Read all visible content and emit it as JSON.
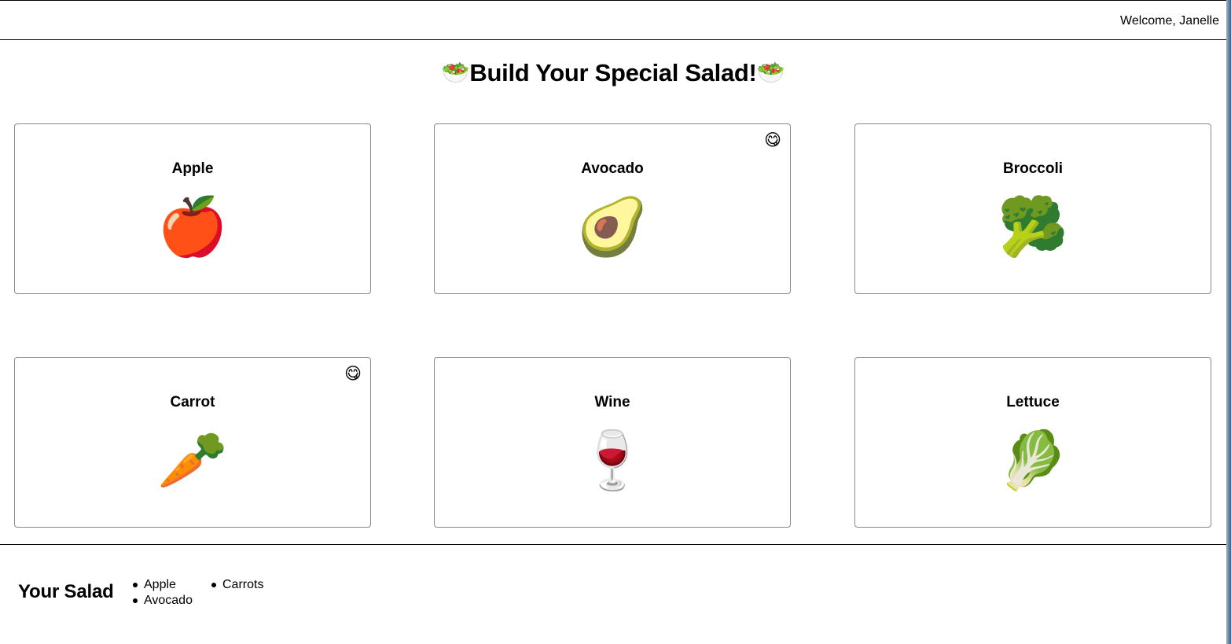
{
  "header": {
    "welcome_text": "Welcome, Janelle"
  },
  "page": {
    "title_icon": "🥗",
    "title": "Build Your Special Salad!"
  },
  "ingredients": [
    {
      "name": "Apple",
      "emoji": "🍎",
      "favorite": false,
      "favorite_icon": ""
    },
    {
      "name": "Avocado",
      "emoji": "🥑",
      "favorite": true,
      "favorite_icon": "😋"
    },
    {
      "name": "Broccoli",
      "emoji": "🥦",
      "favorite": false,
      "favorite_icon": ""
    },
    {
      "name": "Carrot",
      "emoji": "🥕",
      "favorite": true,
      "favorite_icon": "😋"
    },
    {
      "name": "Wine",
      "emoji": "🍷",
      "favorite": false,
      "favorite_icon": ""
    },
    {
      "name": "Lettuce",
      "emoji": "🥬",
      "favorite": false,
      "favorite_icon": ""
    }
  ],
  "salad": {
    "heading": "Your Salad",
    "items": [
      "Apple",
      "Avocado",
      "Carrots"
    ]
  }
}
